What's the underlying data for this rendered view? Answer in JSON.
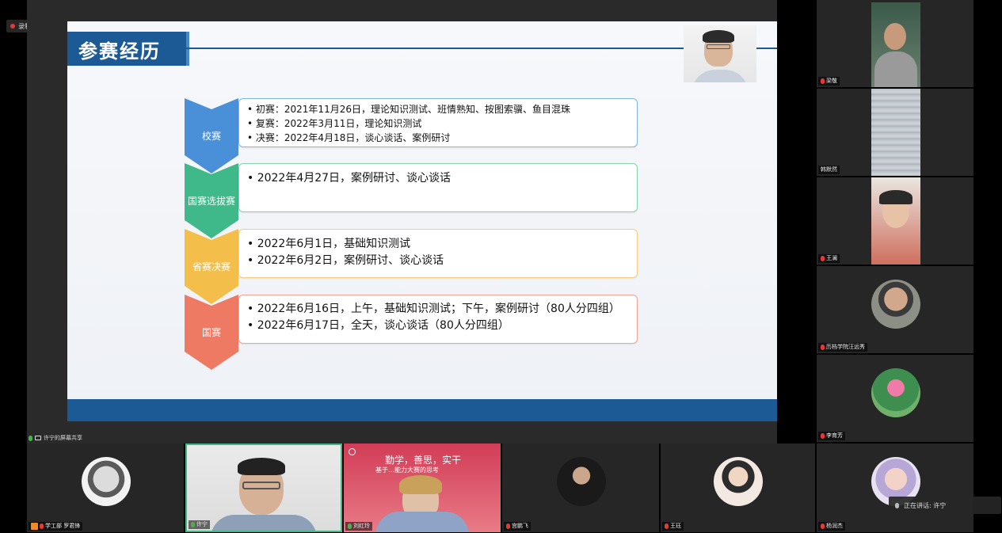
{
  "recording": {
    "label": "录制中"
  },
  "share": {
    "label": "许宁的屏幕共享"
  },
  "slide": {
    "title": "参赛经历",
    "stages": [
      {
        "name": "校赛",
        "color": "#4a90d9",
        "border": "#7fb6e6",
        "size": "small",
        "lines": [
          "• 初赛：2021年11月26日，理论知识测试、班情熟知、按图索骥、鱼目混珠",
          "• 复赛：2022年3月11日，理论知识测试",
          "• 决赛：2022年4月18日，谈心谈话、案例研讨"
        ]
      },
      {
        "name": "国赛选拔赛",
        "color": "#3fb98a",
        "border": "#86d3b0",
        "size": "large",
        "lines": [
          "• 2022年4月27日，案例研讨、谈心谈话"
        ]
      },
      {
        "name": "省赛决赛",
        "color": "#f3bf4a",
        "border": "#f6cf7e",
        "size": "large",
        "lines": [
          "• 2022年6月1日，基础知识测试",
          "• 2022年6月2日，案例研讨、谈心谈话"
        ]
      },
      {
        "name": "国赛",
        "color": "#ee7a63",
        "border": "#f2a595",
        "size": "large",
        "lines": [
          "• 2022年6月16日，上午，基础知识测试；下午，案例研讨（80人分四组）",
          "• 2022年6月17日，全天，谈心谈话（80人分四组）"
        ]
      }
    ]
  },
  "participants_right": [
    {
      "name": "梁敬"
    },
    {
      "name": "韩默然"
    },
    {
      "name": "王澜"
    },
    {
      "name": "历档学院汪远秀"
    },
    {
      "name": "李育芳"
    },
    {
      "name": "杨润杰"
    }
  ],
  "participants_bottom": [
    {
      "name": "学工部 罗君锋"
    },
    {
      "name": "许宁"
    },
    {
      "name": "刘红玲"
    },
    {
      "name": "宫鹏飞"
    },
    {
      "name": "王珏"
    }
  ],
  "banner": {
    "line1": "勤学，善思，实干",
    "line2": "基于…能力大赛的思考"
  },
  "speaking": {
    "label": "正在讲话: 许宁"
  },
  "colors": {
    "accent": "#1c5a96",
    "active_border": "#3fb98a"
  }
}
